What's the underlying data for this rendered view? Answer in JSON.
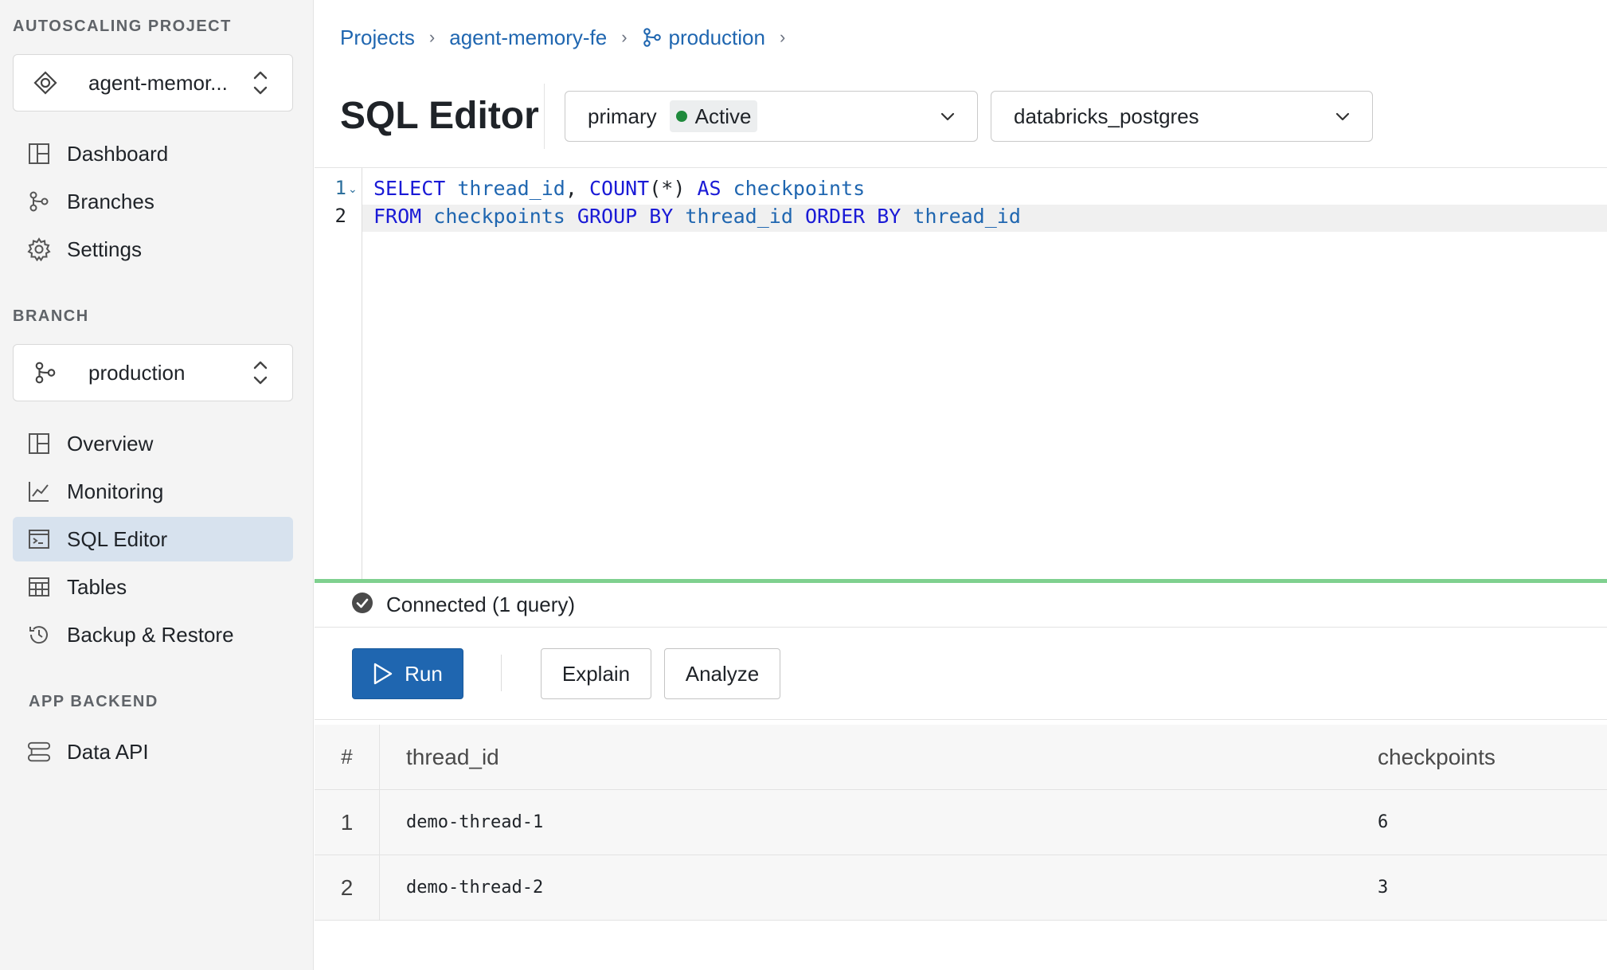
{
  "sidebar": {
    "project_section": "AUTOSCALING PROJECT",
    "project_name": "agent-memor...",
    "project_nav": [
      {
        "label": "Dashboard",
        "icon": "dashboard-icon"
      },
      {
        "label": "Branches",
        "icon": "branch-icon"
      },
      {
        "label": "Settings",
        "icon": "gear-icon"
      }
    ],
    "branch_section": "BRANCH",
    "branch_name": "production",
    "branch_nav": [
      {
        "label": "Overview",
        "icon": "overview-icon"
      },
      {
        "label": "Monitoring",
        "icon": "chart-line-icon"
      },
      {
        "label": "SQL Editor",
        "icon": "terminal-icon",
        "active": true
      },
      {
        "label": "Tables",
        "icon": "table-icon"
      },
      {
        "label": "Backup & Restore",
        "icon": "history-icon"
      }
    ],
    "backend_section": "APP BACKEND",
    "backend_nav": [
      {
        "label": "Data API",
        "icon": "api-icon"
      }
    ]
  },
  "breadcrumb": {
    "items": [
      "Projects",
      "agent-memory-fe",
      "production"
    ]
  },
  "header": {
    "title": "SQL Editor",
    "compute_select": "primary",
    "compute_status": "Active",
    "database_select": "databricks_postgres"
  },
  "editor": {
    "line_numbers": [
      "1",
      "2"
    ],
    "lines": [
      "SELECT thread_id, COUNT(*) AS checkpoints",
      "FROM checkpoints GROUP BY thread_id ORDER BY thread_id"
    ]
  },
  "status": {
    "text": "Connected (1 query)"
  },
  "toolbar": {
    "run_label": "Run",
    "explain_label": "Explain",
    "analyze_label": "Analyze"
  },
  "results": {
    "columns": [
      "#",
      "thread_id",
      "checkpoints"
    ],
    "rows": [
      [
        "1",
        "demo-thread-1",
        "6"
      ],
      [
        "2",
        "demo-thread-2",
        "3"
      ]
    ]
  },
  "colors": {
    "accent": "#1f66b0",
    "active_nav_bg": "#d7e2ee",
    "status_green": "#1f8a3c",
    "connected_bar": "#7fd08f"
  }
}
